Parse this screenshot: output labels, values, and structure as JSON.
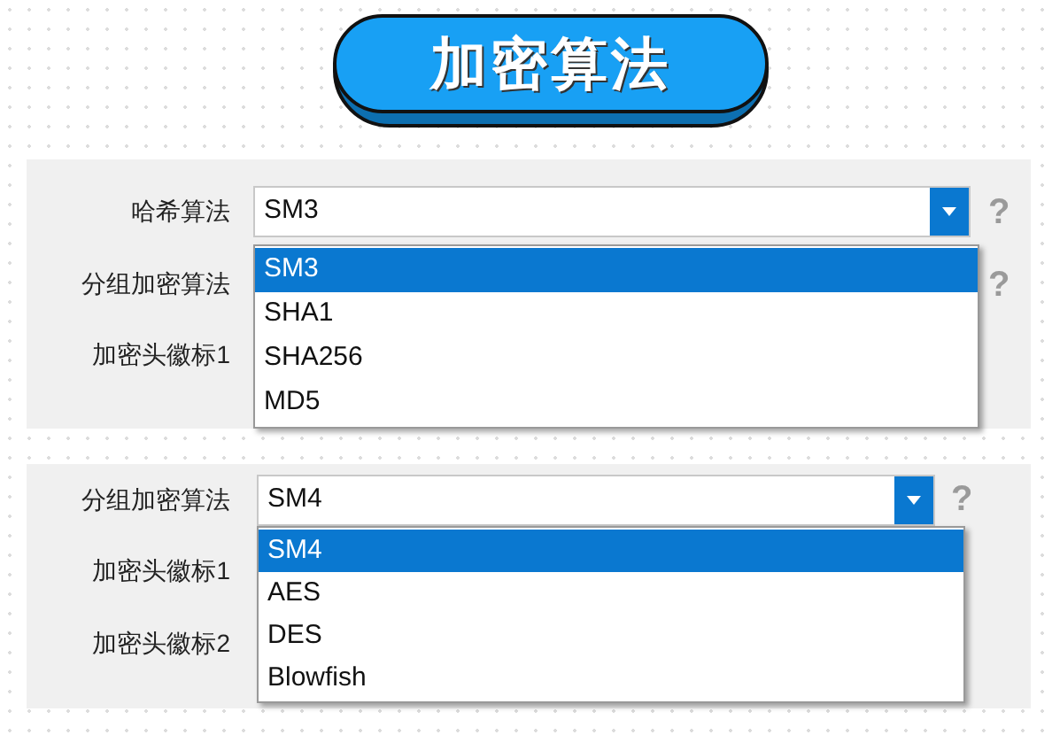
{
  "title": "加密算法",
  "panels": [
    {
      "fields": [
        {
          "label": "哈希算法",
          "value": "SM3",
          "help": "?"
        },
        {
          "label": "分组加密算法",
          "help": "?"
        },
        {
          "label": "加密头徽标1"
        }
      ],
      "dropdown": {
        "options": [
          {
            "label": "SM3",
            "selected": true
          },
          {
            "label": "SHA1",
            "selected": false
          },
          {
            "label": "SHA256",
            "selected": false
          },
          {
            "label": "MD5",
            "selected": false
          }
        ]
      }
    },
    {
      "fields": [
        {
          "label": "分组加密算法",
          "value": "SM4",
          "help": "?"
        },
        {
          "label": "加密头徽标1"
        },
        {
          "label": "加密头徽标2"
        }
      ],
      "dropdown": {
        "options": [
          {
            "label": "SM4",
            "selected": true
          },
          {
            "label": "AES",
            "selected": false
          },
          {
            "label": "DES",
            "selected": false
          },
          {
            "label": "Blowfish",
            "selected": false
          }
        ]
      }
    }
  ]
}
